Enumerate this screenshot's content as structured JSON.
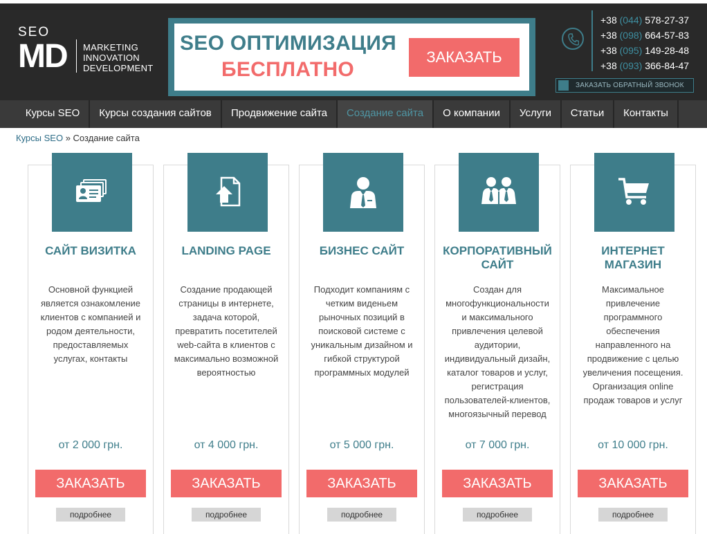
{
  "logo": {
    "top": "SEO",
    "mark": "MD",
    "tagline": [
      "MARKETING",
      "INNOVATION",
      "DEVELOPMENT"
    ]
  },
  "promo": {
    "line1": "SEO ОПТИМИЗАЦИЯ",
    "line2": "БЕСПЛАТНО",
    "button": "ЗАКАЗАТЬ"
  },
  "contacts": {
    "phones": [
      {
        "prefix": "+38",
        "code": "(044)",
        "number": "578-27-37"
      },
      {
        "prefix": "+38",
        "code": "(098)",
        "number": "664-57-83"
      },
      {
        "prefix": "+38",
        "code": "(095)",
        "number": "149-28-48"
      },
      {
        "prefix": "+38",
        "code": "(093)",
        "number": "366-84-47"
      }
    ],
    "callback": "ЗАКАЗАТЬ ОБРАТНЫЙ ЗВОНОК"
  },
  "nav": {
    "items": [
      {
        "label": "Курсы SEO"
      },
      {
        "label": "Курсы создания сайтов"
      },
      {
        "label": "Продвижение сайта"
      },
      {
        "label": "Создание сайта",
        "active": true
      },
      {
        "label": "О компании"
      },
      {
        "label": "Услуги"
      },
      {
        "label": "Статьи"
      },
      {
        "label": "Контакты"
      }
    ]
  },
  "breadcrumb": {
    "link": "Курсы SEO",
    "separator": " » ",
    "current": "Создание сайта"
  },
  "cards": [
    {
      "icon": "business-card-icon",
      "title": "САЙТ ВИЗИТКА",
      "desc": "Основной функцией является ознакомление клиентов с компанией и родом деятельности, предоставляемых услугах, контакты",
      "price": "от 2 000 грн.",
      "order": "ЗАКАЗАТЬ",
      "more": "подробнее"
    },
    {
      "icon": "upload-page-icon",
      "title": "LANDING PAGE",
      "desc": "Создание продающей страницы в интернете, задача которой, превратить посетителей web-сайта в клиентов с максимально возможной вероятностью",
      "price": "от 4 000 грн.",
      "order": "ЗАКАЗАТЬ",
      "more": "подробнее"
    },
    {
      "icon": "businessman-icon",
      "title": "БИЗНЕС САЙТ",
      "desc": "Подходит компаниям с четким виденьем рыночных позиций в поисковой системе с уникальным дизайном и гибкой структурой программных модулей",
      "price": "от 5 000 грн.",
      "order": "ЗАКАЗАТЬ",
      "more": "подробнее"
    },
    {
      "icon": "team-icon",
      "title": "КОРПОРАТИВНЫЙ САЙТ",
      "desc": "Создан для многофункциональности и максимального привлечения целевой аудитории, индивидуальный дизайн, каталог товаров и услуг, регистрация пользователей-клиентов, многоязычный перевод",
      "price": "от 7 000 грн.",
      "order": "ЗАКАЗАТЬ",
      "more": "подробнее"
    },
    {
      "icon": "shopping-cart-icon",
      "title": "ИНТЕРНЕТ МАГАЗИН",
      "desc": "Максимальное привлечение программного обеспечения направленного на продвижение с целью увеличения посещения. Организация online продаж товаров и услуг",
      "price": "от 10 000 грн.",
      "order": "ЗАКАЗАТЬ",
      "more": "подробнее"
    }
  ],
  "colors": {
    "accent": "#3e7d8a",
    "cta": "#f26b6b",
    "header_bg": "#292929",
    "nav_bg": "#3a3a3a"
  }
}
